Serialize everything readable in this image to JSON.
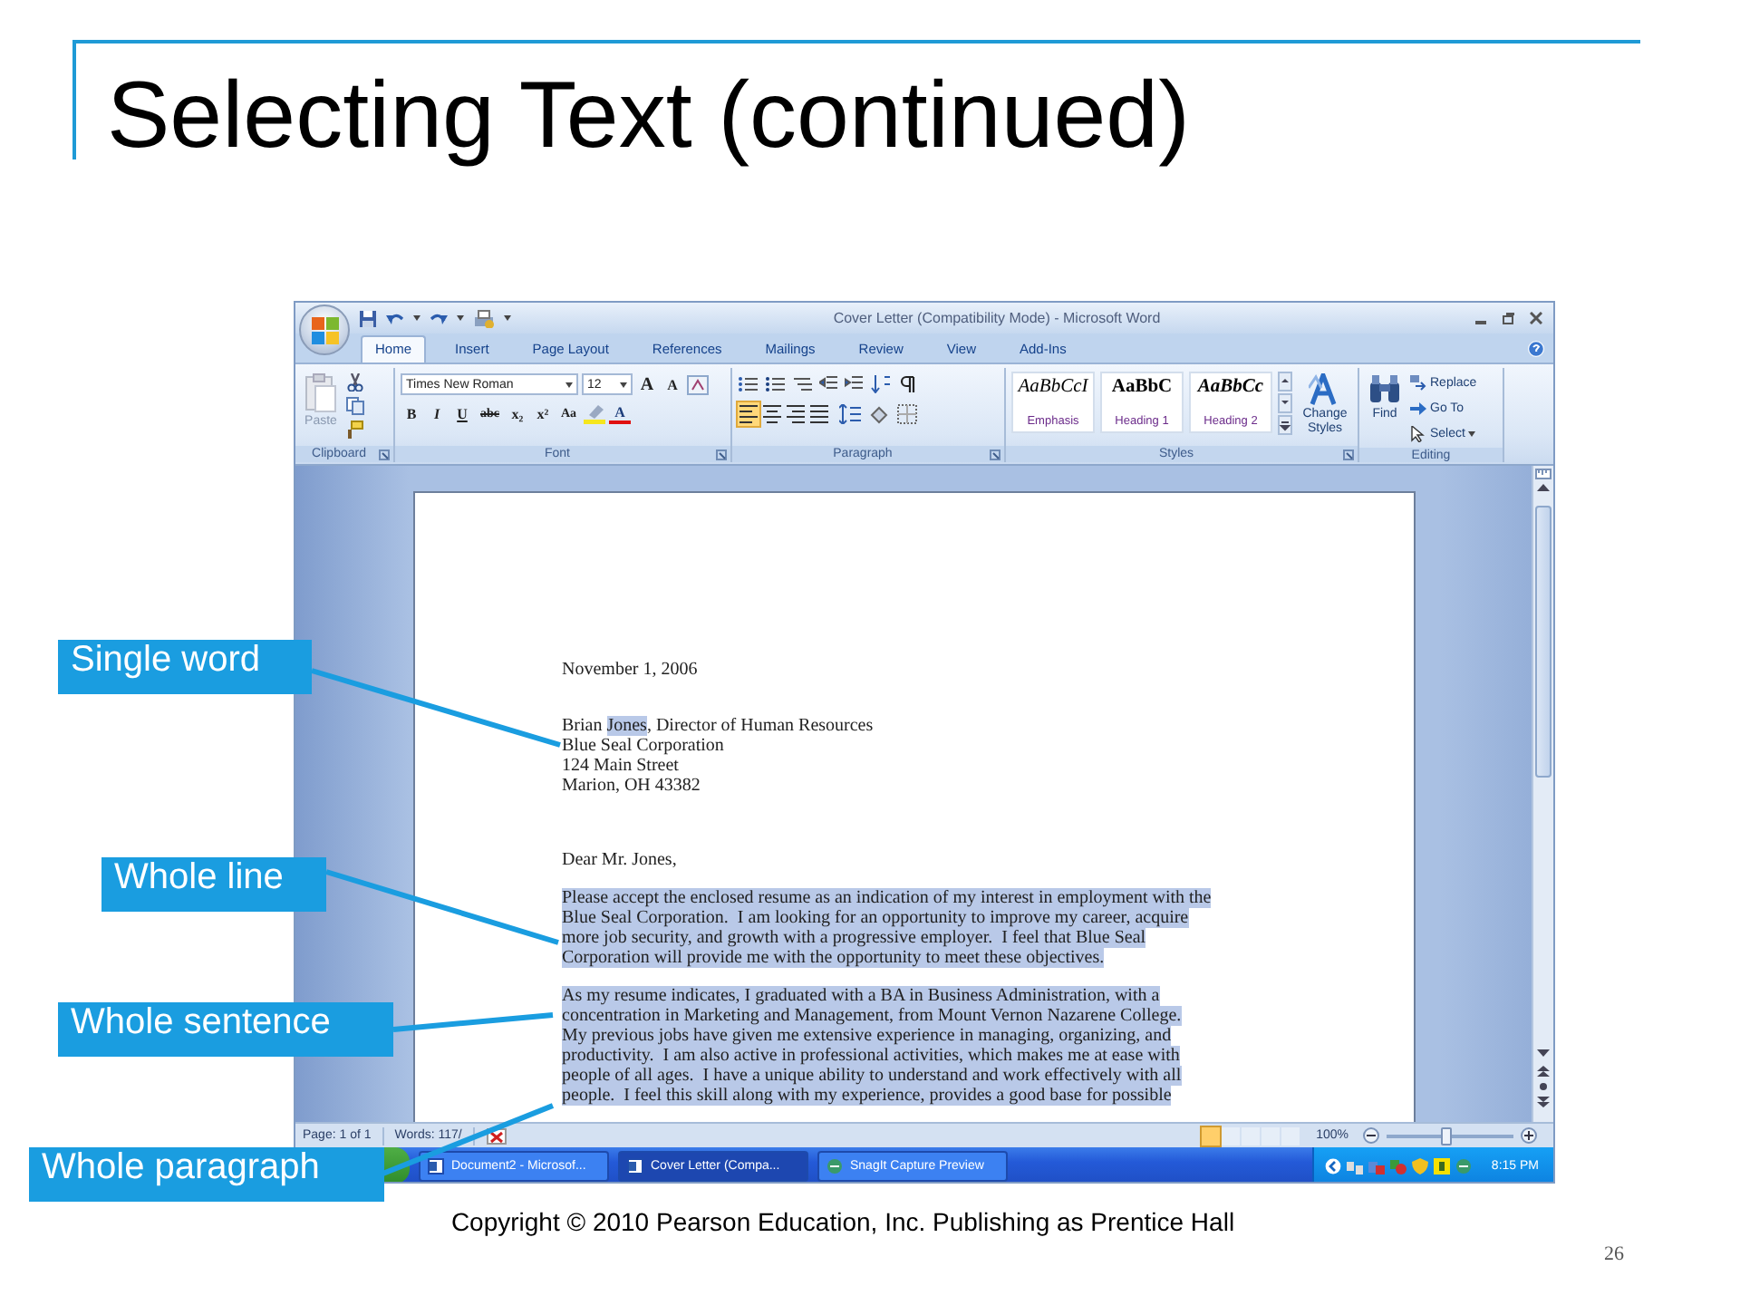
{
  "slide": {
    "title": "Selecting Text (continued)",
    "footer": "Copyright © 2010 Pearson Education, Inc. Publishing as Prentice Hall",
    "page_number": "26"
  },
  "callouts": [
    {
      "label": "Single word"
    },
    {
      "label": "Whole line"
    },
    {
      "label": "Whole sentence"
    },
    {
      "label": "Whole paragraph"
    }
  ],
  "word_window": {
    "title": "Cover Letter (Compatibility Mode) - Microsoft Word",
    "tabs": [
      {
        "label": "Home",
        "selected": true
      },
      {
        "label": "Insert",
        "selected": false
      },
      {
        "label": "Page Layout",
        "selected": false
      },
      {
        "label": "References",
        "selected": false
      },
      {
        "label": "Mailings",
        "selected": false
      },
      {
        "label": "Review",
        "selected": false
      },
      {
        "label": "View",
        "selected": false
      },
      {
        "label": "Add-Ins",
        "selected": false
      }
    ],
    "ribbon": {
      "groups": [
        {
          "kind": "clipboard",
          "caption": "Clipboard",
          "paste": "Paste"
        },
        {
          "kind": "font",
          "caption": "Font",
          "font_name": "Times New Roman",
          "font_size": "12",
          "grow": "A",
          "shrink": "A",
          "bold": "B",
          "italic": "I",
          "underline": "U",
          "strikethrough": "abc",
          "subscript": "x₂",
          "superscript": "x²",
          "change_case": "Aa",
          "font_color": "A"
        },
        {
          "kind": "paragraph",
          "caption": "Paragraph",
          "alignments": [
            {
              "on": true
            },
            {
              "on": false
            },
            {
              "on": false
            },
            {
              "on": false
            }
          ]
        },
        {
          "kind": "styles",
          "caption": "Styles",
          "styles": [
            {
              "sample": "AaBbCcI",
              "name": "Emphasis"
            },
            {
              "sample": "AaBbC",
              "name": "Heading 1"
            },
            {
              "sample": "AaBbCc",
              "name": "Heading 2"
            }
          ],
          "change_styles": "Change Styles"
        },
        {
          "kind": "editing",
          "caption": "Editing",
          "find": "Find",
          "replace": "Replace",
          "go_to": "Go To",
          "select": "Select"
        }
      ]
    },
    "document": {
      "paragraphs": [
        {
          "lines": [
            {
              "segments": [
                {
                  "text": "November 1, 2006",
                  "selected": false
                }
              ]
            }
          ]
        },
        {
          "lines": [
            {
              "segments": [
                {
                  "text": "Brian ",
                  "selected": false
                },
                {
                  "text": "Jones",
                  "selected": true
                },
                {
                  "text": ", Director of Human Resources",
                  "selected": false
                }
              ]
            },
            {
              "segments": [
                {
                  "text": "Blue Seal Corporation",
                  "selected": false
                }
              ]
            },
            {
              "segments": [
                {
                  "text": "124 Main Street",
                  "selected": false
                }
              ]
            },
            {
              "segments": [
                {
                  "text": "Marion, OH 43382",
                  "selected": false
                }
              ]
            }
          ]
        },
        {
          "lines": [
            {
              "segments": [
                {
                  "text": "Dear Mr. Jones,",
                  "selected": false
                }
              ]
            }
          ]
        },
        {
          "lines": [
            {
              "segments": [
                {
                  "text": "Please accept the enclosed resume as an indication of my interest in employment with the",
                  "selected": true
                }
              ]
            },
            {
              "segments": [
                {
                  "text": "Blue Seal Corporation.  I am looking for an opportunity to improve my career, acquire",
                  "selected": true
                }
              ]
            },
            {
              "segments": [
                {
                  "text": "more job security, and growth with a progressive employer.  I feel that Blue Seal",
                  "selected": true
                }
              ]
            },
            {
              "segments": [
                {
                  "text": "Corporation will provide me with the opportunity to meet these objectives.",
                  "selected": true
                }
              ]
            }
          ]
        },
        {
          "lines": [
            {
              "segments": [
                {
                  "text": "As my resume indicates, I graduated with a BA in Business Administration, with a",
                  "selected": true
                }
              ]
            },
            {
              "segments": [
                {
                  "text": "concentration in Marketing and Management, from Mount Vernon Nazarene College.",
                  "selected": true
                }
              ]
            },
            {
              "segments": [
                {
                  "text": "My previous jobs have given me extensive experience in managing, organizing, and",
                  "selected": true
                }
              ]
            },
            {
              "segments": [
                {
                  "text": "productivity.  I am also active in professional activities, which makes me at ease with",
                  "selected": true
                }
              ]
            },
            {
              "segments": [
                {
                  "text": "people of all ages.  I have a unique ability to understand and work effectively with all",
                  "selected": true
                }
              ]
            },
            {
              "segments": [
                {
                  "text": "people.  I feel this skill along with my experience, provides a good base for possible",
                  "selected": true
                }
              ]
            }
          ]
        }
      ]
    },
    "status_bar": {
      "page": "Page: 1 of 1",
      "words": "Words: 117/",
      "views": [
        {
          "selected": true
        },
        {
          "selected": false
        },
        {
          "selected": false
        },
        {
          "selected": false
        },
        {
          "selected": false
        }
      ],
      "zoom": {
        "reading": "100%",
        "level": 0.47
      }
    },
    "taskbar": {
      "tasks": [
        {
          "label": "Document2 - Microsof...",
          "selected": false
        },
        {
          "label": "Cover Letter (Compa...",
          "selected": true
        },
        {
          "label": "SnagIt Capture Preview",
          "selected": false
        }
      ],
      "clock": "8:15 PM"
    }
  }
}
